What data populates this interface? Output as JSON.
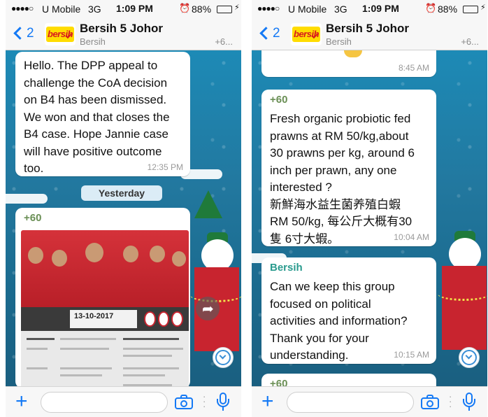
{
  "status_bar": {
    "signal": "●●●●○",
    "carrier": "U Mobile",
    "network": "3G",
    "time": "1:09 PM",
    "battery_pct": "88%",
    "battery_level": 0.88
  },
  "header": {
    "back_count": "2",
    "group_name": "Bersih 5 Johor",
    "group_sub": "Bersih",
    "group_sub_extra": "+6...",
    "logo_text": "bersih"
  },
  "left_screen": {
    "message1": {
      "lines": [
        "Hello. The DPP appeal to",
        "challenge the CoA decision",
        "on B4 has been dismissed.",
        "We won and that closes the",
        "B4 case. Hope Jannie case",
        "will have positive outcome",
        "too."
      ],
      "time": "12:35 PM"
    },
    "date_chip": "Yesterday",
    "message2": {
      "sender": "+60",
      "poster_date": "13-10-2017"
    }
  },
  "right_screen": {
    "message0": {
      "time": "8:45 AM"
    },
    "message1": {
      "sender": "+60",
      "lines": [
        "Fresh organic probiotic fed",
        "prawns  at RM 50/kg,about",
        "30 prawns per kg,  around 6",
        "inch per prawn,  any one",
        "interested ?",
        "新鮮海水益生菌养殖白蝦",
        "RM 50/kg, 每公斤大概有30",
        "隻 6寸大蝦。"
      ],
      "time": "10:04 AM"
    },
    "message2": {
      "sender": "Bersih",
      "lines": [
        "Can we keep this group",
        "focused on political",
        "activities and information?",
        "Thank you for your",
        "understanding."
      ],
      "time": "10:15 AM"
    },
    "message3": {
      "sender": "+60"
    }
  },
  "input_bar": {
    "plus": "+",
    "placeholder": ""
  },
  "colors": {
    "accent": "#1479f5",
    "sender_green": "#6a8f55",
    "sender_teal": "#2a9b8e",
    "chat_bg": "#1d8ab6"
  }
}
